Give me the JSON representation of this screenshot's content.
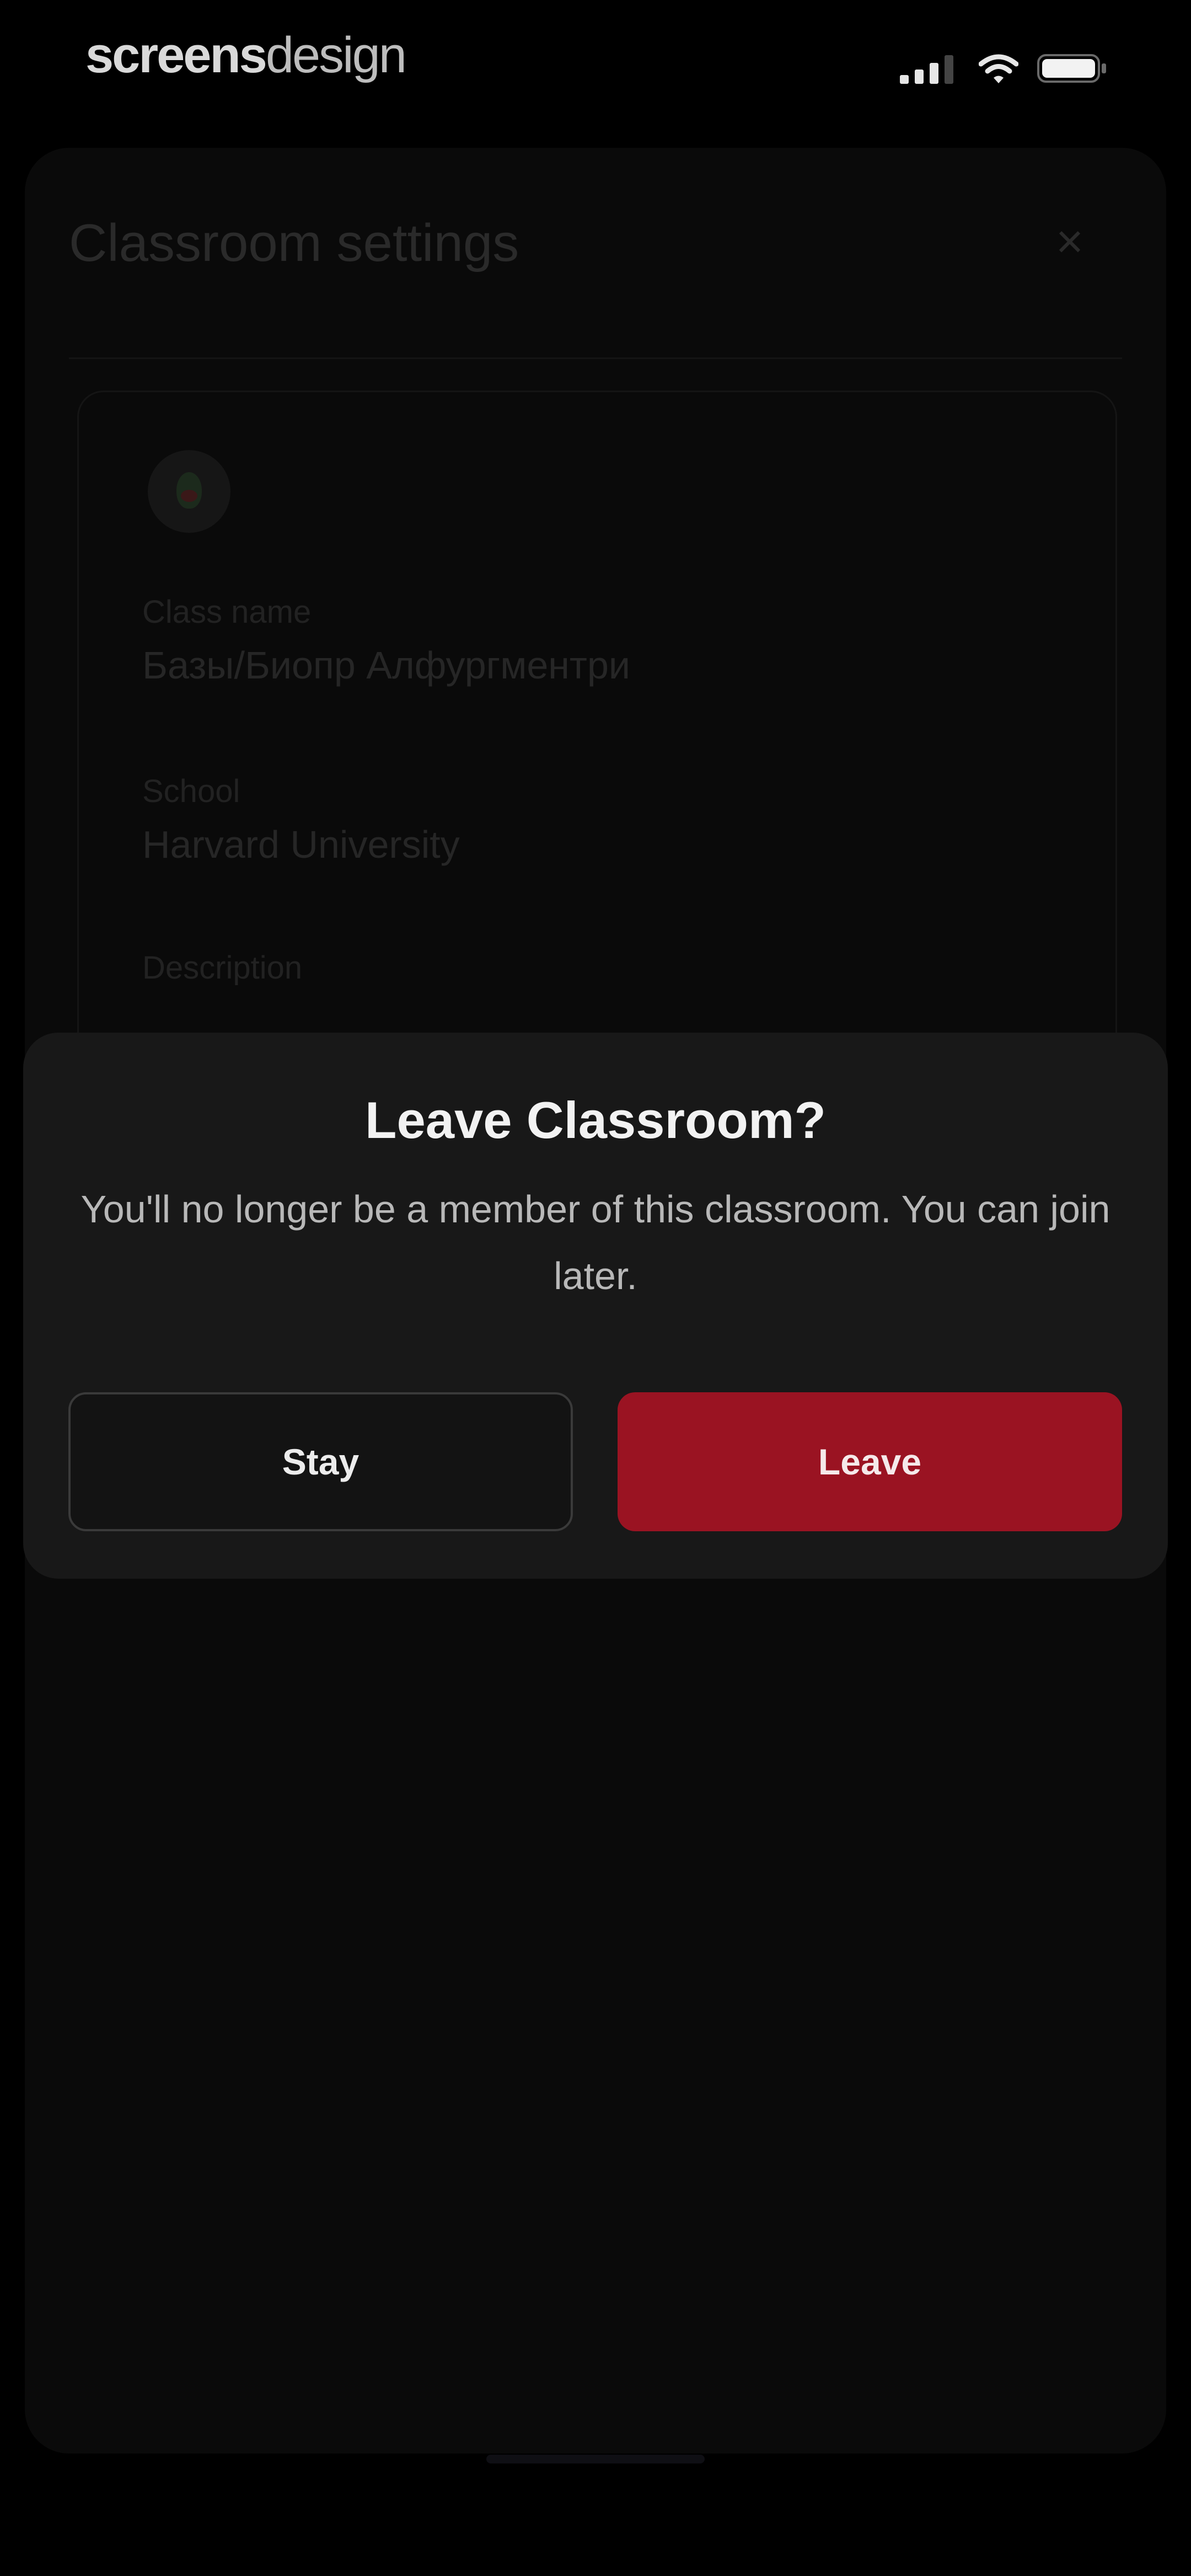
{
  "status_bar": {
    "brand_bold": "screens",
    "brand_light": "design",
    "icons": [
      "signal-icon",
      "wifi-icon",
      "battery-icon"
    ]
  },
  "sheet": {
    "title": "Classroom settings",
    "close_icon": "close-icon",
    "fields": [
      {
        "label": "Class name",
        "value": "Базы/Биопр Алфургментри"
      },
      {
        "label": "School",
        "value": "Harvard University"
      },
      {
        "label": "Description",
        "value": ""
      }
    ]
  },
  "dialog": {
    "title": "Leave Classroom?",
    "message": "You'll no longer be a member of this classroom. You can join later.",
    "stay_label": "Stay",
    "leave_label": "Leave"
  },
  "colors": {
    "background": "#000000",
    "dialog_bg": "#181818",
    "leave_button": "#9a1322",
    "stay_border": "#3a3a3a"
  }
}
